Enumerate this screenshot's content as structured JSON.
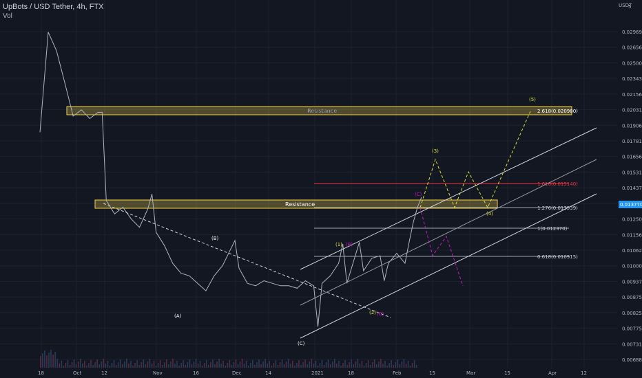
{
  "header": {
    "title": "UpBots / USD Tether, 4h, FTX",
    "vol_label": "Vol",
    "currency": "USDT",
    "scale_mark": "5"
  },
  "colors": {
    "background": "#131722",
    "up": "#b2b5be",
    "resistance": "#f5d34a",
    "channel": "#d1d4dc",
    "fib_red": "#f23645",
    "wave_yellow": "#d8e03a",
    "wave_magenta": "#c41ec4",
    "price_tag": "#2196f3"
  },
  "chart_data": {
    "type": "line",
    "y_axis": {
      "ticks": [
        "0.029690",
        "0.026560",
        "0.025000",
        "0.023435",
        "0.021560",
        "0.020310",
        "0.019065",
        "0.017810",
        "0.016560",
        "0.015310",
        "0.014375",
        "0.013435",
        "0.012500",
        "0.011560",
        "0.010625",
        "0.010000",
        "0.009375",
        "0.008750",
        "0.008250",
        "0.007750",
        "0.007310",
        "0.006885"
      ]
    },
    "x_axis": {
      "ticks": [
        "18",
        "Oct",
        "12",
        "Nov",
        "16",
        "Dec",
        "14",
        "2021",
        "18",
        "Feb",
        "15",
        "Mar",
        "15",
        "Apr",
        "12"
      ]
    },
    "last_price": "0.013770",
    "price_path": [
      [
        0,
        0.0185
      ],
      [
        2,
        0.0296
      ],
      [
        4,
        0.0262
      ],
      [
        6,
        0.0229
      ],
      [
        8,
        0.0198
      ],
      [
        10,
        0.0203
      ],
      [
        12,
        0.0196
      ],
      [
        14,
        0.0201
      ],
      [
        15,
        0.0201
      ],
      [
        16,
        0.0136
      ],
      [
        18,
        0.0128
      ],
      [
        20,
        0.0132
      ],
      [
        22,
        0.0125
      ],
      [
        24,
        0.012
      ],
      [
        26,
        0.0131
      ],
      [
        27,
        0.014
      ],
      [
        28,
        0.0117
      ],
      [
        30,
        0.0109
      ],
      [
        32,
        0.0101
      ],
      [
        34,
        0.0097
      ],
      [
        36,
        0.0096
      ],
      [
        38,
        0.0093
      ],
      [
        40,
        0.009
      ],
      [
        42,
        0.0096
      ],
      [
        44,
        0.01
      ],
      [
        46,
        0.0107
      ],
      [
        47,
        0.0112
      ],
      [
        48,
        0.0099
      ],
      [
        50,
        0.0093
      ],
      [
        52,
        0.0092
      ],
      [
        54,
        0.0094
      ],
      [
        56,
        0.0093
      ],
      [
        58,
        0.0092
      ],
      [
        60,
        0.0092
      ],
      [
        62,
        0.0091
      ],
      [
        64,
        0.0094
      ],
      [
        66,
        0.0092
      ],
      [
        67,
        0.0078
      ],
      [
        68,
        0.0093
      ],
      [
        70,
        0.0096
      ],
      [
        72,
        0.0101
      ],
      [
        73,
        0.011
      ],
      [
        74,
        0.0093
      ],
      [
        76,
        0.0104
      ],
      [
        77,
        0.0111
      ],
      [
        78,
        0.0098
      ],
      [
        80,
        0.0103
      ],
      [
        82,
        0.0104
      ],
      [
        83,
        0.0094
      ],
      [
        84,
        0.0101
      ],
      [
        86,
        0.0105
      ],
      [
        88,
        0.0101
      ],
      [
        89,
        0.0111
      ],
      [
        90,
        0.0123
      ],
      [
        91,
        0.0132
      ],
      [
        92,
        0.0138
      ]
    ],
    "annotations": {
      "resistance_labels": [
        "Resistance",
        "Resistance"
      ],
      "fib_levels": [
        {
          "label": "2.618(0.020980)",
          "value": 0.02098
        },
        {
          "label": "1.618(0.015140)",
          "value": 0.01514
        },
        {
          "label": "1.276(0.013539)",
          "value": 0.01354
        },
        {
          "label": "1(0.012370)",
          "value": 0.01237
        },
        {
          "label": "0.618(0.010915)",
          "value": 0.010915
        }
      ],
      "wave_labels": [
        "(A)",
        "(B)",
        "(C)",
        "(1)",
        "(2)",
        "(3)",
        "(4)",
        "(5)",
        "(C)",
        "(B)",
        "(C)"
      ]
    }
  }
}
